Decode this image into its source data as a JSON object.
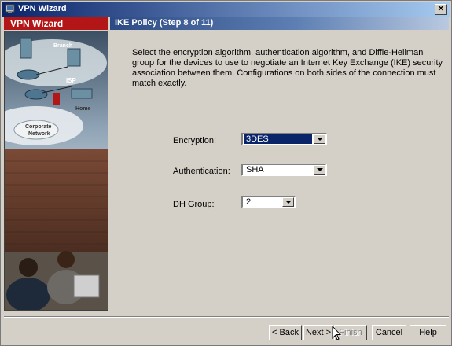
{
  "window": {
    "title": "VPN Wizard",
    "close_glyph": "✕"
  },
  "sidebar": {
    "title": "VPN Wizard",
    "diagram_labels": [
      "Branch",
      "ISP",
      "Home",
      "Corporate",
      "Network"
    ]
  },
  "step": {
    "title": "IKE Policy  (Step 8 of 11)"
  },
  "description": "Select the encryption algorithm, authentication algorithm, and Diffie-Hellman group for the devices to use to negotiate an Internet Key Exchange (IKE) security association between them.  Configurations on both sides of the connection must match exactly.",
  "form": {
    "encryption": {
      "label": "Encryption:",
      "value": "3DES"
    },
    "authentication": {
      "label": "Authentication:",
      "value": "SHA"
    },
    "dh_group": {
      "label": "DH Group:",
      "value": "2"
    }
  },
  "buttons": {
    "back": "< Back",
    "next": "Next >",
    "finish": "Finish",
    "cancel": "Cancel",
    "help": "Help"
  },
  "colors": {
    "sidebar_accent": "#b31616",
    "title_bar": "#0a246a",
    "selection": "#0a246a"
  }
}
